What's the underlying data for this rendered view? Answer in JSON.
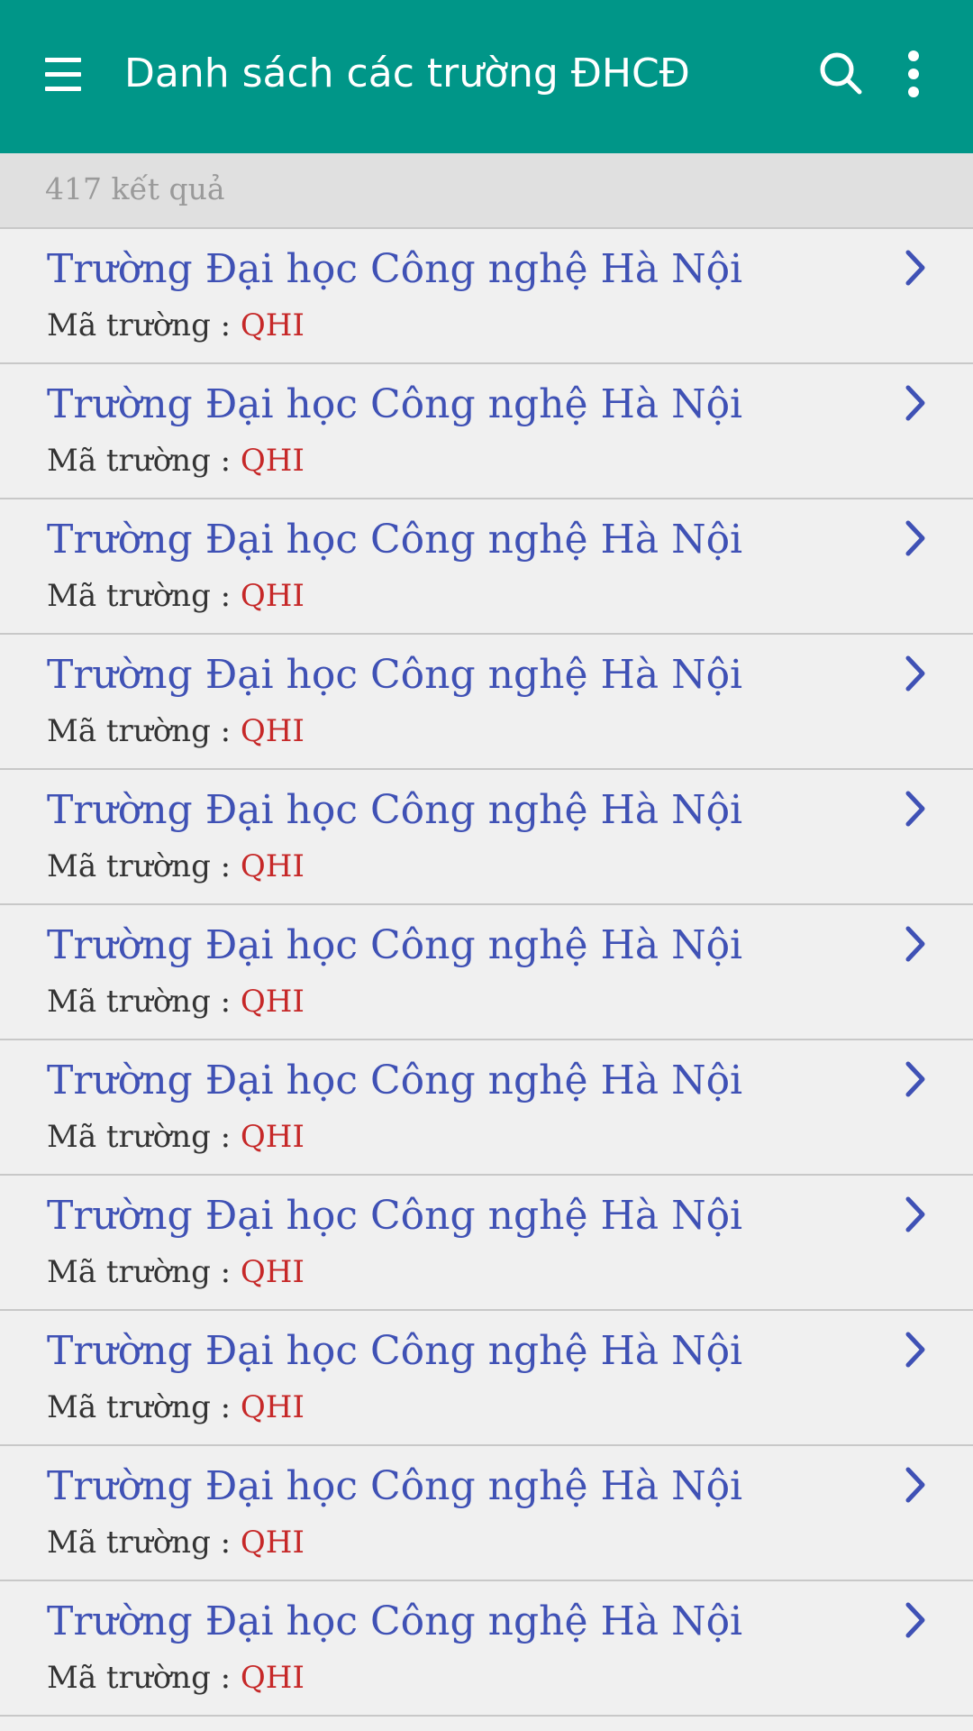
{
  "appbar": {
    "title": "Danh sách các trường ĐHCĐ",
    "menu_icon": "hamburger-menu-icon",
    "search_icon": "search-icon",
    "more_icon": "more-vert-icon",
    "color": "#009688"
  },
  "results": {
    "count_text": "417 kết quả"
  },
  "list": {
    "code_label": "Mã trường :",
    "chevron_icon": "chevron-right-icon",
    "items": [
      {
        "name": "Trường Đại học Công nghệ Hà Nội",
        "code": "QHI"
      },
      {
        "name": "Trường Đại học Công nghệ Hà Nội",
        "code": "QHI"
      },
      {
        "name": "Trường Đại học Công nghệ Hà Nội",
        "code": "QHI"
      },
      {
        "name": "Trường Đại học Công nghệ Hà Nội",
        "code": "QHI"
      },
      {
        "name": "Trường Đại học Công nghệ Hà Nội",
        "code": "QHI"
      },
      {
        "name": "Trường Đại học Công nghệ Hà Nội",
        "code": "QHI"
      },
      {
        "name": "Trường Đại học Công nghệ Hà Nội",
        "code": "QHI"
      },
      {
        "name": "Trường Đại học Công nghệ Hà Nội",
        "code": "QHI"
      },
      {
        "name": "Trường Đại học Công nghệ Hà Nội",
        "code": "QHI"
      },
      {
        "name": "Trường Đại học Công nghệ Hà Nội",
        "code": "QHI"
      },
      {
        "name": "Trường Đại học Công nghệ Hà Nội",
        "code": "QHI"
      }
    ]
  },
  "colors": {
    "name_text": "#3f51b5",
    "code_value": "#c62828",
    "background": "#f0f0f0"
  }
}
